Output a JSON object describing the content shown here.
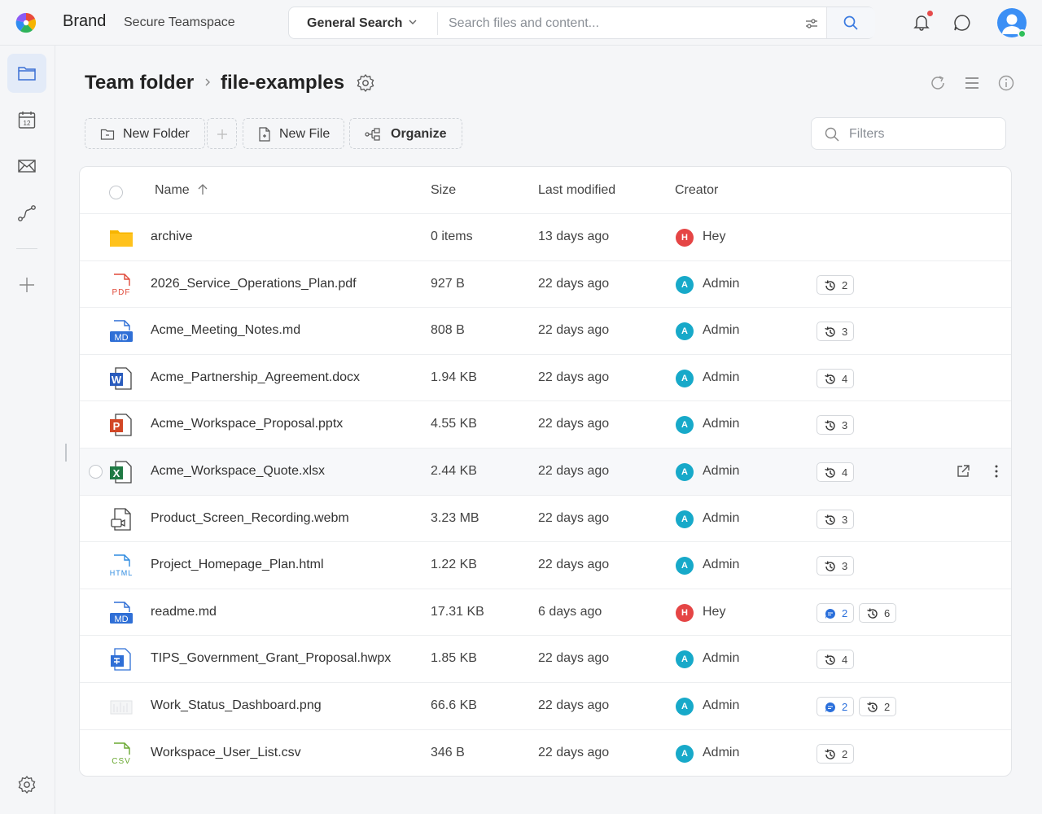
{
  "header": {
    "brand": "Brand",
    "workspace": "Secure Teamspace",
    "search_scope": "General Search",
    "search_placeholder": "Search files and content...",
    "logo_icon": "pinwheel-logo",
    "accent": "#3b8ff5"
  },
  "rail": {
    "items": [
      {
        "name": "files",
        "icon": "folder-icon",
        "active": true
      },
      {
        "name": "calendar",
        "icon": "calendar-icon",
        "badge_text": "12"
      },
      {
        "name": "mail",
        "icon": "mail-icon"
      },
      {
        "name": "workflow",
        "icon": "route-icon"
      },
      {
        "name": "add",
        "icon": "plus-icon"
      }
    ],
    "settings_icon": "gear-icon"
  },
  "breadcrumb": {
    "root": "Team folder",
    "current": "file-examples"
  },
  "toolbar": {
    "new_folder": "New Folder",
    "new_file": "New File",
    "organize": "Organize",
    "filters_placeholder": "Filters"
  },
  "table": {
    "columns": {
      "name": "Name",
      "size": "Size",
      "modified": "Last modified",
      "creator": "Creator"
    },
    "rows": [
      {
        "name": "archive",
        "type": "folder",
        "size": "0 items",
        "modified": "13 days ago",
        "creator": "Hey",
        "initial": "H",
        "avatar_color": "#e54545",
        "versions": null,
        "comments": null
      },
      {
        "name": "2026_Service_Operations_Plan.pdf",
        "type": "pdf",
        "size": "927 B",
        "modified": "22 days ago",
        "creator": "Admin",
        "initial": "A",
        "avatar_color": "#17a9c9",
        "versions": "2",
        "comments": null
      },
      {
        "name": "Acme_Meeting_Notes.md",
        "type": "md",
        "size": "808 B",
        "modified": "22 days ago",
        "creator": "Admin",
        "initial": "A",
        "avatar_color": "#17a9c9",
        "versions": "3",
        "comments": null
      },
      {
        "name": "Acme_Partnership_Agreement.docx",
        "type": "docx",
        "size": "1.94 KB",
        "modified": "22 days ago",
        "creator": "Admin",
        "initial": "A",
        "avatar_color": "#17a9c9",
        "versions": "4",
        "comments": null
      },
      {
        "name": "Acme_Workspace_Proposal.pptx",
        "type": "pptx",
        "size": "4.55 KB",
        "modified": "22 days ago",
        "creator": "Admin",
        "initial": "A",
        "avatar_color": "#17a9c9",
        "versions": "3",
        "comments": null
      },
      {
        "name": "Acme_Workspace_Quote.xlsx",
        "type": "xlsx",
        "size": "2.44 KB",
        "modified": "22 days ago",
        "creator": "Admin",
        "initial": "A",
        "avatar_color": "#17a9c9",
        "versions": "4",
        "comments": null,
        "hover": true
      },
      {
        "name": "Product_Screen_Recording.webm",
        "type": "video",
        "size": "3.23 MB",
        "modified": "22 days ago",
        "creator": "Admin",
        "initial": "A",
        "avatar_color": "#17a9c9",
        "versions": "3",
        "comments": null
      },
      {
        "name": "Project_Homepage_Plan.html",
        "type": "html",
        "size": "1.22 KB",
        "modified": "22 days ago",
        "creator": "Admin",
        "initial": "A",
        "avatar_color": "#17a9c9",
        "versions": "3",
        "comments": null
      },
      {
        "name": "readme.md",
        "type": "md",
        "size": "17.31 KB",
        "modified": "6 days ago",
        "creator": "Hey",
        "initial": "H",
        "avatar_color": "#e54545",
        "versions": "6",
        "comments": "2"
      },
      {
        "name": "TIPS_Government_Grant_Proposal.hwpx",
        "type": "hwpx",
        "size": "1.85 KB",
        "modified": "22 days ago",
        "creator": "Admin",
        "initial": "A",
        "avatar_color": "#17a9c9",
        "versions": "4",
        "comments": null
      },
      {
        "name": "Work_Status_Dashboard.png",
        "type": "png",
        "size": "66.6 KB",
        "modified": "22 days ago",
        "creator": "Admin",
        "initial": "A",
        "avatar_color": "#17a9c9",
        "versions": "2",
        "comments": "2"
      },
      {
        "name": "Workspace_User_List.csv",
        "type": "csv",
        "size": "346 B",
        "modified": "22 days ago",
        "creator": "Admin",
        "initial": "A",
        "avatar_color": "#17a9c9",
        "versions": "2",
        "comments": null
      }
    ]
  }
}
